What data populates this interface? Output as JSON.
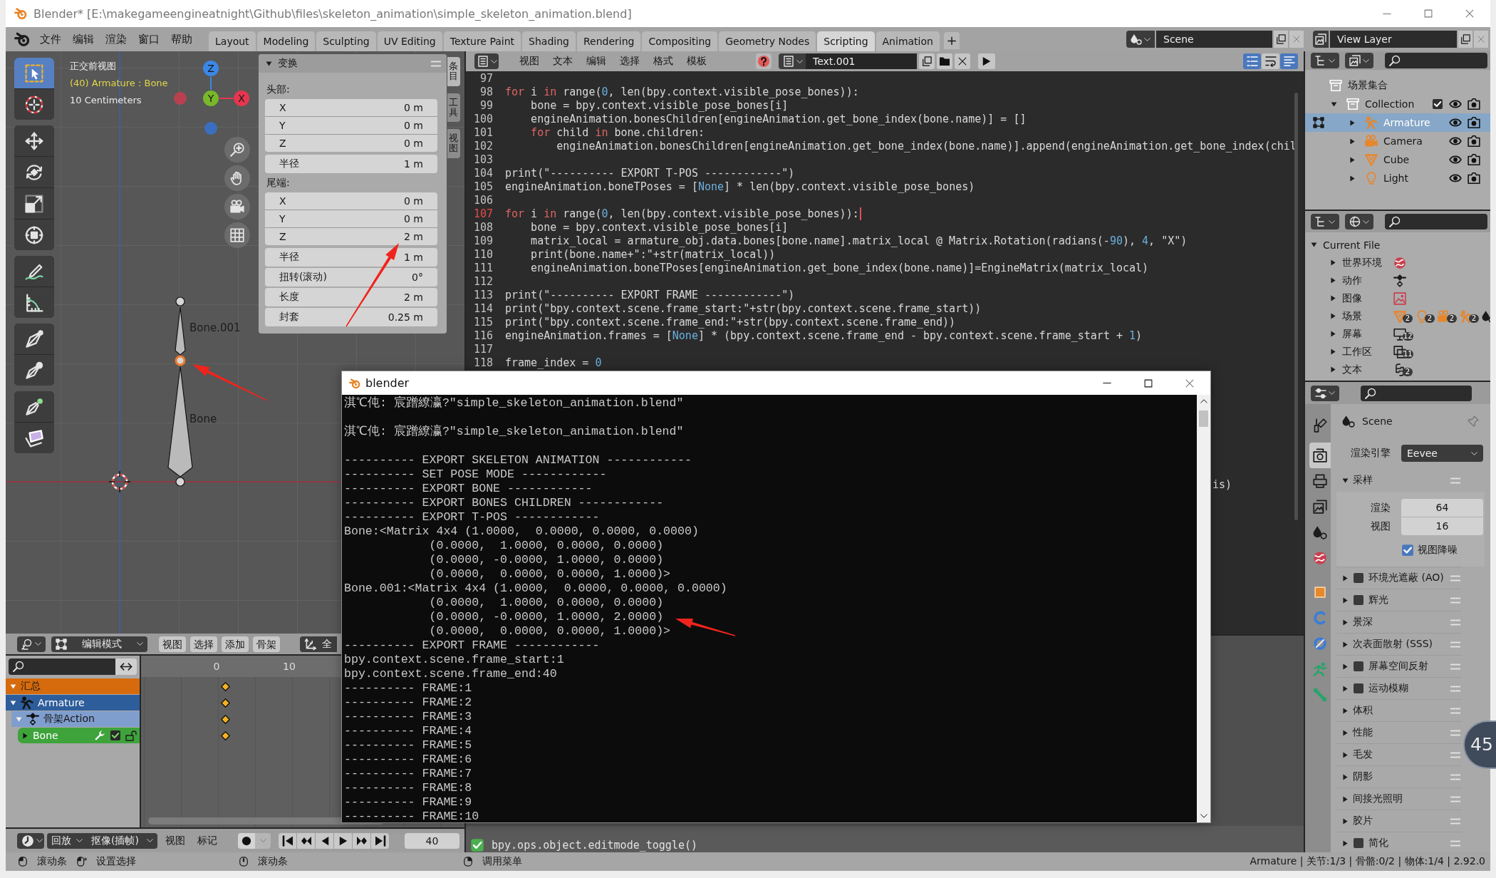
{
  "window": {
    "title": "Blender* [E:\\makegameengineatnight\\Github\\files\\skeleton_animation\\simple_skeleton_animation.blend]"
  },
  "menus": [
    "文件",
    "编辑",
    "渲染",
    "窗口",
    "帮助"
  ],
  "workspaces": [
    {
      "label": "Layout",
      "selected": false
    },
    {
      "label": "Modeling",
      "selected": false
    },
    {
      "label": "Sculpting",
      "selected": false
    },
    {
      "label": "UV Editing",
      "selected": false
    },
    {
      "label": "Texture Paint",
      "selected": false
    },
    {
      "label": "Shading",
      "selected": false
    },
    {
      "label": "Rendering",
      "selected": false
    },
    {
      "label": "Compositing",
      "selected": false
    },
    {
      "label": "Geometry Nodes",
      "selected": false
    },
    {
      "label": "Scripting",
      "selected": true
    },
    {
      "label": "Animation",
      "selected": false
    }
  ],
  "add_workspace": "+",
  "scene": "Scene",
  "view_layer": "View Layer",
  "viewport": {
    "overlay": [
      {
        "kind": "view",
        "text": "正交前视图"
      },
      {
        "kind": "object",
        "text": "(40) Armature : Bone"
      },
      {
        "kind": "scale",
        "text": "10 Centimeters"
      }
    ],
    "tool_groups": [
      [
        {
          "kind": "select-box",
          "selected": true
        },
        {
          "kind": "cursor",
          "selected": false
        }
      ],
      [
        {
          "kind": "move",
          "selected": false
        },
        {
          "kind": "rotate",
          "selected": false
        },
        {
          "kind": "scale",
          "selected": false
        },
        {
          "kind": "transform",
          "selected": false
        }
      ],
      [
        {
          "kind": "annotate",
          "selected": false
        },
        {
          "kind": "measure",
          "selected": false
        }
      ],
      [
        {
          "kind": "roll",
          "selected": false
        },
        {
          "kind": "bone-size",
          "selected": false
        }
      ],
      [
        {
          "kind": "extrude",
          "selected": false
        },
        {
          "kind": "shear",
          "selected": false
        }
      ]
    ],
    "gizmo": [
      {
        "kind": "positive",
        "label": "Z",
        "color": "#3c87e6"
      },
      {
        "kind": "positive",
        "label": "Y",
        "color": "#78b82a"
      },
      {
        "kind": "positive",
        "label": "X",
        "color": "#e6364f"
      },
      {
        "kind": "negative",
        "color": "#b9414f"
      },
      {
        "kind": "negative",
        "color": "#3a6fc0"
      }
    ],
    "nav_buttons": [
      {
        "kind": "zoom"
      },
      {
        "kind": "pan"
      },
      {
        "kind": "camera"
      },
      {
        "kind": "grid"
      }
    ],
    "bones": [
      {
        "label": "Bone.001",
        "selected": false
      },
      {
        "label": "Bone",
        "selected": false
      }
    ],
    "joints": [
      {
        "selected": false
      },
      {
        "selected": true
      },
      {
        "selected": false
      }
    ],
    "transform": {
      "title": "变换",
      "expanded": true,
      "groups": [
        {
          "label": "头部:",
          "vector": [
            {
              "label": "X",
              "value": "0 m"
            },
            {
              "label": "Y",
              "value": "0 m"
            },
            {
              "label": "Z",
              "value": "0 m"
            }
          ],
          "fields": [
            {
              "label": "半径",
              "value": "1 m"
            }
          ]
        },
        {
          "label": "尾端:",
          "vector": [
            {
              "label": "X",
              "value": "0 m"
            },
            {
              "label": "Y",
              "value": "0 m"
            },
            {
              "label": "Z",
              "value": "2 m"
            }
          ],
          "fields": [
            {
              "label": "半径",
              "value": "1 m"
            },
            {
              "label": "扭转(滚动)",
              "value": "0°"
            },
            {
              "label": "长度",
              "value": "2 m"
            },
            {
              "label": "封套",
              "value": "0.25 m"
            }
          ]
        }
      ]
    },
    "sidebar_tabs": [
      {
        "label": "条目",
        "selected": true
      },
      {
        "label": "工具",
        "selected": false
      },
      {
        "label": "视图",
        "selected": false
      }
    ],
    "header": {
      "mode": "编辑模式",
      "menus": [
        "视图",
        "选择",
        "添加",
        "骨架"
      ],
      "orientation": "全"
    }
  },
  "text_editor": {
    "menus": [
      "视图",
      "文本",
      "编辑",
      "选择",
      "格式",
      "模板"
    ],
    "text_name": "Text.001",
    "toggles": [
      {
        "kind": "line-numbers",
        "on": true
      },
      {
        "kind": "word-wrap",
        "on": false
      },
      {
        "kind": "syntax",
        "on": true
      }
    ],
    "lines": [
      {
        "number": "97",
        "current": false
      },
      {
        "number": "98",
        "current": false,
        "tokens": [
          {
            "kind": "keyword",
            "text": "for"
          },
          {
            "kind": "plain",
            "text": " i "
          },
          {
            "kind": "keyword",
            "text": "in"
          },
          {
            "kind": "plain",
            "text": " range("
          },
          {
            "kind": "number",
            "text": "0"
          },
          {
            "kind": "plain",
            "text": ", len(bpy.context.visible_pose_bones)):"
          }
        ]
      },
      {
        "number": "99",
        "current": false,
        "tokens": [
          {
            "kind": "plain",
            "text": "    bone = bpy.context.visible_pose_bones[i]"
          }
        ]
      },
      {
        "number": "100",
        "current": false,
        "tokens": [
          {
            "kind": "plain",
            "text": "    engineAnimation.bonesChildren[engineAnimation.get_bone_index(bone.name)] = []"
          }
        ]
      },
      {
        "number": "101",
        "current": false,
        "tokens": [
          {
            "kind": "keyword",
            "text": "    for"
          },
          {
            "kind": "plain",
            "text": " child "
          },
          {
            "kind": "keyword",
            "text": "in"
          },
          {
            "kind": "plain",
            "text": " bone.children:"
          }
        ]
      },
      {
        "number": "102",
        "current": false,
        "tokens": [
          {
            "kind": "plain",
            "text": "        engineAnimation.bonesChildren[engineAnimation.get_bone_index(bone.name)].append(engineAnimation.get_bone_index(chil"
          }
        ]
      },
      {
        "number": "103",
        "current": false
      },
      {
        "number": "104",
        "current": false,
        "tokens": [
          {
            "kind": "plain",
            "text": "print(\"---------- EXPORT T-POS ------------\")"
          }
        ]
      },
      {
        "number": "105",
        "current": false,
        "tokens": [
          {
            "kind": "plain",
            "text": "engineAnimation.boneTPoses = ["
          },
          {
            "kind": "number",
            "text": "None"
          },
          {
            "kind": "plain",
            "text": "] * len(bpy.context.visible_pose_bones)"
          }
        ]
      },
      {
        "number": "106",
        "current": false
      },
      {
        "number": "107",
        "current": true,
        "tokens": [
          {
            "kind": "keyword",
            "text": "for"
          },
          {
            "kind": "plain",
            "text": " i "
          },
          {
            "kind": "keyword",
            "text": "in"
          },
          {
            "kind": "plain",
            "text": " range("
          },
          {
            "kind": "number",
            "text": "0"
          },
          {
            "kind": "plain",
            "text": ", len(bpy.context.visible_pose_bones)):"
          }
        ]
      },
      {
        "number": "108",
        "current": false,
        "tokens": [
          {
            "kind": "plain",
            "text": "    bone = bpy.context.visible_pose_bones[i]"
          }
        ]
      },
      {
        "number": "109",
        "current": false,
        "tokens": [
          {
            "kind": "plain",
            "text": "    matrix_local = armature_obj.data.bones[bone.name].matrix_local @ Matrix.Rotation(radians(-"
          },
          {
            "kind": "number",
            "text": "90"
          },
          {
            "kind": "plain",
            "text": "), "
          },
          {
            "kind": "number",
            "text": "4"
          },
          {
            "kind": "plain",
            "text": ", \"X\")"
          }
        ]
      },
      {
        "number": "110",
        "current": false,
        "tokens": [
          {
            "kind": "plain",
            "text": "    print(bone.name+\":\"+str(matrix_local))"
          }
        ]
      },
      {
        "number": "111",
        "current": false,
        "tokens": [
          {
            "kind": "plain",
            "text": "    engineAnimation.boneTPoses[engineAnimation.get_bone_index(bone.name)]=EngineMatrix(matrix_local)"
          }
        ]
      },
      {
        "number": "112",
        "current": false
      },
      {
        "number": "113",
        "current": false,
        "tokens": [
          {
            "kind": "plain",
            "text": "print(\"---------- EXPORT FRAME ------------\")"
          }
        ]
      },
      {
        "number": "114",
        "current": false,
        "tokens": [
          {
            "kind": "plain",
            "text": "print(\"bpy.context.scene.frame_start:\"+str(bpy.context.scene.frame_start))"
          }
        ]
      },
      {
        "number": "115",
        "current": false,
        "tokens": [
          {
            "kind": "plain",
            "text": "print(\"bpy.context.scene.frame_end:\"+str(bpy.context.scene.frame_end))"
          }
        ]
      },
      {
        "number": "116",
        "current": false,
        "tokens": [
          {
            "kind": "plain",
            "text": "engineAnimation.frames = ["
          },
          {
            "kind": "number",
            "text": "None"
          },
          {
            "kind": "plain",
            "text": "] * (bpy.context.scene.frame_end - bpy.context.scene.frame_start + "
          },
          {
            "kind": "number",
            "text": "1"
          },
          {
            "kind": "plain",
            "text": ")"
          }
        ]
      },
      {
        "number": "117",
        "current": false
      },
      {
        "number": "118",
        "current": false,
        "tokens": [
          {
            "kind": "plain",
            "text": "frame_index = "
          },
          {
            "kind": "number",
            "text": "0"
          }
        ]
      }
    ],
    "fragment": "is)"
  },
  "info_log": [
    "bpy.ops.object.editmode_toggle()"
  ],
  "dopesheet": {
    "ruler": [
      "0",
      "10"
    ],
    "channels": [
      {
        "label": "汇总",
        "kind": "summary",
        "expanded": true,
        "keyed": true,
        "children": [
          {
            "label": "Armature",
            "kind": "object",
            "expanded": true,
            "keyed": true,
            "children": [
              {
                "label": "骨架Action",
                "kind": "action",
                "expanded": true,
                "keyed": true,
                "children": [
                  {
                    "label": "Bone",
                    "kind": "group",
                    "expanded": false,
                    "keyed": true,
                    "enabled": true,
                    "locked": false
                  }
                ]
              }
            ]
          }
        ]
      }
    ]
  },
  "timeline": {
    "playback": "回放",
    "keying": "抠像(插帧)",
    "menus": [
      "视图",
      "标记"
    ],
    "auto_keying": false,
    "frame": "40"
  },
  "outliner": {
    "items": [
      {
        "label": "场景集合",
        "kind": "scene-collection",
        "selected": false,
        "children": [
          {
            "label": "Collection",
            "kind": "collection",
            "expanded": true,
            "selected": false,
            "included": true,
            "visible": true,
            "renderable": true,
            "children": [
              {
                "label": "Armature",
                "kind": "armature",
                "expanded": false,
                "selected": true,
                "edit_mode": true,
                "visible": true,
                "renderable": true
              },
              {
                "label": "Camera",
                "kind": "camera",
                "expanded": false,
                "selected": false,
                "edit_mode": false,
                "visible": true,
                "renderable": true
              },
              {
                "label": "Cube",
                "kind": "mesh",
                "expanded": false,
                "selected": false,
                "edit_mode": false,
                "visible": true,
                "renderable": true
              },
              {
                "label": "Light",
                "kind": "light",
                "expanded": false,
                "selected": false,
                "edit_mode": false,
                "visible": true,
                "renderable": true
              }
            ]
          }
        ]
      }
    ]
  },
  "blend_file": {
    "root": "Current File",
    "expanded": true,
    "items": [
      {
        "label": "世界环境",
        "expanded": false,
        "blocks": [
          {
            "kind": "world"
          }
        ]
      },
      {
        "label": "动作",
        "expanded": false,
        "blocks": [
          {
            "kind": "action"
          }
        ]
      },
      {
        "label": "图像",
        "expanded": false,
        "blocks": [
          {
            "kind": "image"
          }
        ]
      },
      {
        "label": "场景",
        "expanded": false,
        "blocks": [
          {
            "kind": "mesh",
            "count": "2"
          },
          {
            "kind": "light",
            "count": "2"
          },
          {
            "kind": "camera",
            "count": "2"
          },
          {
            "kind": "armature",
            "count": "2"
          },
          {
            "kind": "scene"
          }
        ]
      },
      {
        "label": "屏幕",
        "expanded": false,
        "blocks": [
          {
            "kind": "screen",
            "count": "12"
          }
        ]
      },
      {
        "label": "工作区",
        "expanded": false,
        "blocks": [
          {
            "kind": "workspace",
            "count": "11"
          }
        ]
      },
      {
        "label": "文本",
        "expanded": false,
        "blocks": [
          {
            "kind": "text",
            "count": "2"
          }
        ]
      }
    ]
  },
  "properties": {
    "tabs": [
      {
        "kind": "tool",
        "selected": false
      },
      {
        "kind": "render",
        "selected": true
      },
      {
        "kind": "output",
        "selected": false
      },
      {
        "kind": "view-layer",
        "selected": false
      },
      {
        "kind": "scene",
        "selected": false
      },
      {
        "kind": "world",
        "selected": false
      },
      {
        "kind": "object",
        "selected": false
      },
      {
        "kind": "physics",
        "selected": false
      },
      {
        "kind": "constraints",
        "selected": false
      },
      {
        "kind": "data",
        "selected": false
      },
      {
        "kind": "bone",
        "selected": false
      }
    ],
    "context": "Scene",
    "engine": {
      "label": "渲染引擎",
      "value": "Eevee"
    },
    "panels": [
      {
        "label": "采样",
        "kind": "plain",
        "expanded": true,
        "fields": [
          {
            "label": "渲染",
            "value": "64"
          },
          {
            "label": "视图",
            "value": "16"
          }
        ],
        "option": {
          "label": "视图降噪",
          "checked": true
        }
      },
      {
        "label": "环境光遮蔽 (AO)",
        "kind": "toggle",
        "expanded": false,
        "enabled": false
      },
      {
        "label": "辉光",
        "kind": "toggle",
        "expanded": false,
        "enabled": false
      },
      {
        "label": "景深",
        "kind": "plain",
        "expanded": false
      },
      {
        "label": "次表面散射 (SSS)",
        "kind": "plain",
        "expanded": false
      },
      {
        "label": "屏幕空间反射",
        "kind": "toggle",
        "expanded": false,
        "enabled": false
      },
      {
        "label": "运动模糊",
        "kind": "toggle",
        "expanded": false,
        "enabled": false
      },
      {
        "label": "体积",
        "kind": "plain",
        "expanded": false
      },
      {
        "label": "性能",
        "kind": "plain",
        "expanded": false
      },
      {
        "label": "毛发",
        "kind": "plain",
        "expanded": false
      },
      {
        "label": "阴影",
        "kind": "plain",
        "expanded": false
      },
      {
        "label": "间接光照明",
        "kind": "plain",
        "expanded": false
      },
      {
        "label": "胶片",
        "kind": "plain",
        "expanded": false
      },
      {
        "label": "简化",
        "kind": "toggle",
        "expanded": false,
        "enabled": false
      }
    ]
  },
  "console": {
    "title": "blender",
    "messages": [
      "淇℃伅: 宸蹭繚瀛?\"simple_skeleton_animation.blend\"",
      "淇℃伅: 宸蹭繚瀛?\"simple_skeleton_animation.blend\""
    ],
    "output": [
      "---------- EXPORT SKELETON ANIMATION ------------",
      "---------- SET POSE MODE ------------",
      "---------- EXPORT BONE ------------",
      "---------- EXPORT BONES CHILDREN ------------",
      "---------- EXPORT T-POS ------------",
      "Bone:<Matrix 4x4 (1.0000,  0.0000, 0.0000, 0.0000)",
      "            (0.0000,  1.0000, 0.0000, 0.0000)",
      "            (0.0000, -0.0000, 1.0000, 0.0000)",
      "            (0.0000,  0.0000, 0.0000, 1.0000)>",
      "Bone.001:<Matrix 4x4 (1.0000,  0.0000, 0.0000, 0.0000)",
      "            (0.0000,  1.0000, 0.0000, 0.0000)",
      "            (0.0000, -0.0000, 1.0000, 2.0000)",
      "            (0.0000,  0.0000, 0.0000, 1.0000)>",
      "---------- EXPORT FRAME ------------",
      "bpy.context.scene.frame_start:1",
      "bpy.context.scene.frame_end:40",
      "---------- FRAME:1",
      "---------- FRAME:2",
      "---------- FRAME:3",
      "---------- FRAME:4",
      "---------- FRAME:5",
      "---------- FRAME:6",
      "---------- FRAME:7",
      "---------- FRAME:8",
      "---------- FRAME:9",
      "---------- FRAME:10"
    ]
  },
  "status_bar": {
    "hints": [
      {
        "kind": "left",
        "label": "滚动条"
      },
      {
        "kind": "drag",
        "label": "设置选择"
      },
      {
        "kind": "middle",
        "label": "滚动条"
      },
      {
        "kind": "right",
        "label": "调用菜单"
      }
    ],
    "stats": "Armature | 关节:1/3 | 骨骼:0/2 | 物体:1/4 | 2.92.0"
  },
  "floating_button": "45"
}
